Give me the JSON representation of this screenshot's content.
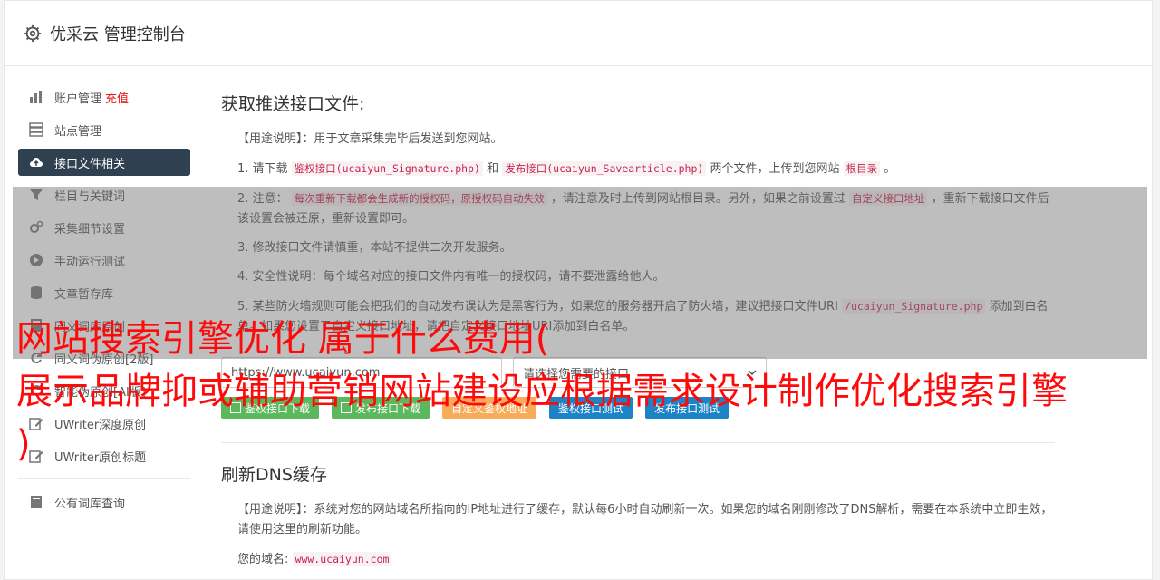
{
  "topbar": {
    "title": "优采云 管理控制台"
  },
  "sidebar": {
    "items": [
      {
        "label": "账户管理",
        "extra": "充值",
        "icon": "bar-chart-icon"
      },
      {
        "label": "站点管理",
        "icon": "server-icon"
      },
      {
        "label": "接口文件相关",
        "icon": "cloud-upload-icon",
        "active": true
      },
      {
        "label": "栏目与关键词",
        "icon": "filter-icon"
      },
      {
        "label": "采集细节设置",
        "icon": "gears-icon"
      },
      {
        "label": "手动运行测试",
        "icon": "play-circle-icon"
      },
      {
        "label": "文章暂存库",
        "icon": "database-icon"
      },
      {
        "label": "同义词库原创",
        "icon": "book-icon"
      },
      {
        "label": "同义词伪原创[2版]",
        "icon": "refresh-icon"
      },
      {
        "label": "智能伪原创[AI版]",
        "icon": "refresh-icon"
      },
      {
        "label": "UWriter深度原创",
        "icon": "edit-icon"
      },
      {
        "label": "UWriter原创标题",
        "icon": "edit-icon"
      },
      {
        "label": "公有词库查询",
        "icon": "book-icon"
      }
    ]
  },
  "main": {
    "section1": {
      "title": "获取推送接口文件:",
      "usage": "【用途说明】：用于文章采集完毕后发送到您网站。",
      "p1": {
        "a": "1. 请下载",
        "code1": "鉴权接口(ucaiyun_Signature.php)",
        "b": "和",
        "code2": "发布接口(ucaiyun_Savearticle.php)",
        "c": "两个文件，上传到您网站",
        "code3": "根目录",
        "d": "。"
      },
      "p2": {
        "a": "2. 注意：",
        "code1": "每次重新下载都会生成新的授权码，原授权码自动失效",
        "b": "，请注意及时上传到网站根目录。另外，如果之前设置过",
        "code2": "自定义接口地址",
        "c": "，重新下载接口文件后该设置会被还原，重新设置即可。"
      },
      "p3": "3. 修改接口文件请慎重，本站不提供二次开发服务。",
      "p4": "4. 安全性说明：每个域名对应的接口文件内有唯一的授权码，请不要泄露给他人。",
      "p5": {
        "a": "5. 某些防火墙规则可能会把我们的自动发布误认为是黑客行为，如果您的服务器开启了防火墙，建议把接口文件URI",
        "code1": "/ucaiyun_Signature.php",
        "b": "添加到白名单。如果您设置了自定义接口地址，请把自定义接口地址URI添加到白名单。"
      },
      "url_value": "https://www.ucaiyun.com",
      "select_placeholder": "请选择您需要的接口",
      "buttons": [
        "鉴权接口下载",
        "发布接口下载",
        "自定义鉴权地址",
        "鉴权接口测试",
        "发布接口测试"
      ]
    },
    "section2": {
      "title": "刷新DNS缓存",
      "usage": "【用途说明】：系统对您的网站域名所指向的IP地址进行了缓存，默认每6小时自动刷新一次。如果您的域名刚刚修改了DNS解析，需要在本系统中立即生效，请使用这里的刷新功能。",
      "domain_label": "您的域名:",
      "domain_value": "www.ucaiyun.com"
    }
  },
  "overlay_text": {
    "line1": "网站搜索引擎优化 属于什么费用(",
    "line2": "展示品牌抑或辅助营销网站建设应根据需求设计制作优化搜索引擎",
    "line3": ")"
  }
}
